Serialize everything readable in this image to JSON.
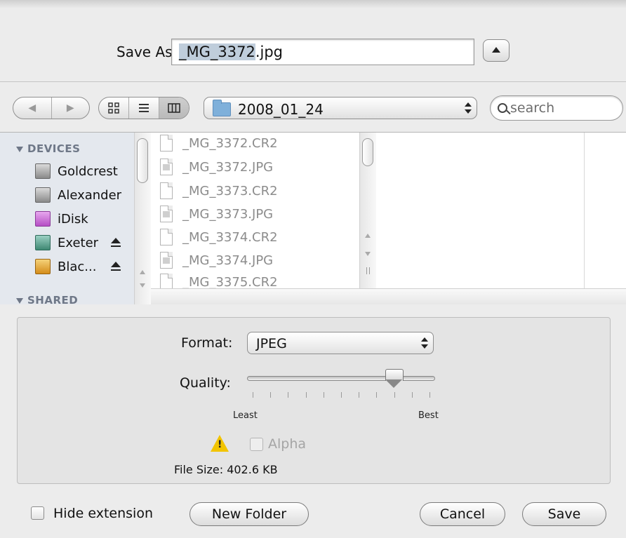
{
  "save_as": {
    "label": "Save As:",
    "filename_selected": "_MG_3372",
    "filename_ext": ".jpg"
  },
  "toolbar": {
    "back_label": "◀",
    "forward_label": "▶",
    "folder": "2008_01_24",
    "search_placeholder": "search"
  },
  "sidebar": {
    "devices_header": "DEVICES",
    "shared_header": "SHARED",
    "items": [
      {
        "label": "Goldcrest",
        "icon": "hard-disk-icon",
        "eject": false
      },
      {
        "label": "Alexander",
        "icon": "hard-disk-icon",
        "eject": false
      },
      {
        "label": "iDisk",
        "icon": "idisk-icon",
        "eject": false
      },
      {
        "label": "Exeter",
        "icon": "time-machine-disk-icon",
        "eject": true
      },
      {
        "label": "Blac...",
        "icon": "external-disk-icon",
        "eject": true
      }
    ]
  },
  "files": [
    {
      "name": "_MG_3372.CR2",
      "type": "raw"
    },
    {
      "name": "_MG_3372.JPG",
      "type": "jpg"
    },
    {
      "name": "_MG_3373.CR2",
      "type": "raw"
    },
    {
      "name": "_MG_3373.JPG",
      "type": "jpg"
    },
    {
      "name": "_MG_3374.CR2",
      "type": "raw"
    },
    {
      "name": "_MG_3374.JPG",
      "type": "jpg"
    },
    {
      "name": "_MG_3375.CR2",
      "type": "raw"
    }
  ],
  "options": {
    "format_label": "Format:",
    "format_value": "JPEG",
    "quality_label": "Quality:",
    "quality_fraction": 0.78,
    "least_label": "Least",
    "best_label": "Best",
    "alpha_label": "Alpha",
    "alpha_enabled": false,
    "file_size_label": "File Size:",
    "file_size_value": "402.6 KB"
  },
  "footer": {
    "hide_extension_label": "Hide extension",
    "new_folder_label": "New Folder",
    "cancel_label": "Cancel",
    "save_label": "Save"
  },
  "colors": {
    "dialog_bg": "#ececec",
    "sidebar_bg": "#e4e8ee",
    "selection": "#bfcddb",
    "warning": "#f2c400"
  }
}
